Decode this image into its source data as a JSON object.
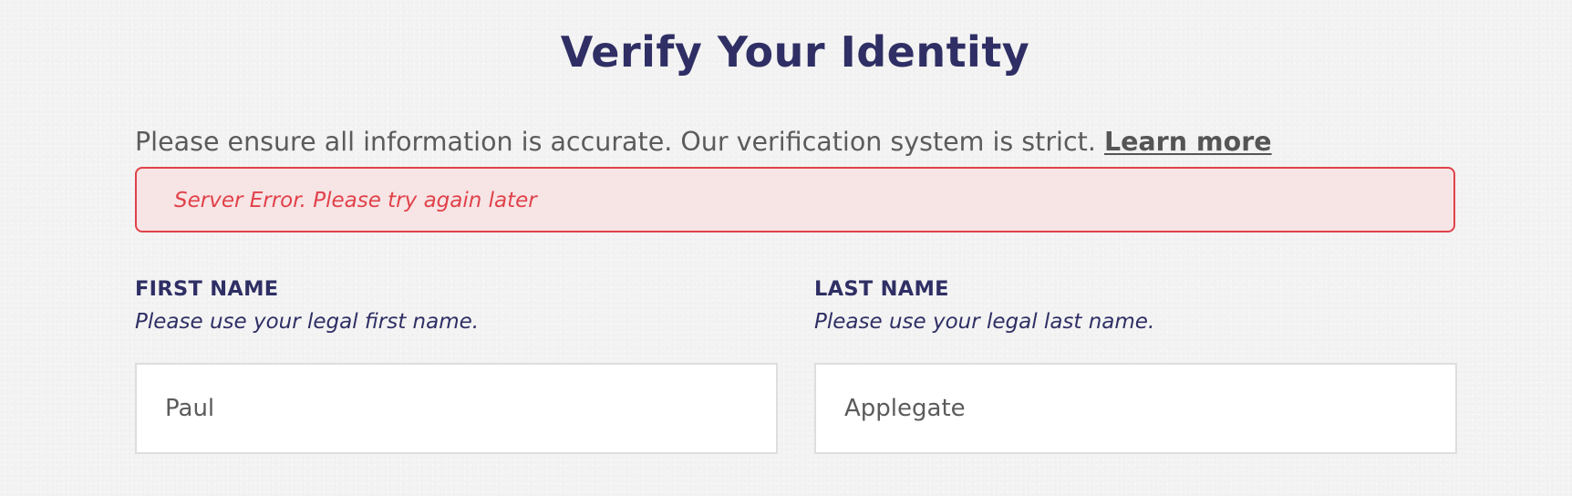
{
  "page": {
    "title": "Verify Your Identity"
  },
  "intro": {
    "text": "Please ensure all information is accurate. Our verification system is strict. ",
    "link_label": "Learn more"
  },
  "error": {
    "message": "Server Error. Please try again later",
    "color": "#e0424a",
    "background": "#f7e4e5"
  },
  "form": {
    "first_name": {
      "label": "FIRST NAME",
      "hint": "Please use your legal first name.",
      "value": "Paul"
    },
    "last_name": {
      "label": "LAST NAME",
      "hint": "Please use your legal last name.",
      "value": "Applegate"
    }
  },
  "colors": {
    "heading": "#2f2f65",
    "body_text": "#5b5b5b"
  }
}
